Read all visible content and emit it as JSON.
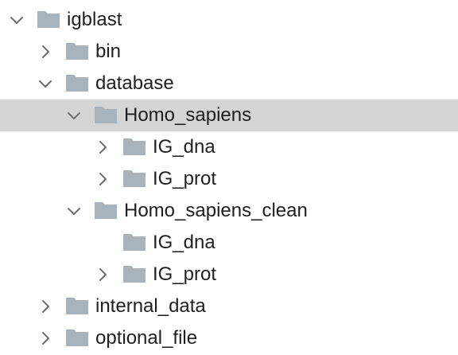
{
  "tree": {
    "root": {
      "label": "igblast",
      "expanded": true
    },
    "bin": {
      "label": "bin",
      "expanded": false
    },
    "database": {
      "label": "database",
      "expanded": true
    },
    "homo_sapiens": {
      "label": "Homo_sapiens",
      "expanded": true,
      "selected": true
    },
    "homo_sapiens_ig_dna": {
      "label": "IG_dna",
      "expanded": false
    },
    "homo_sapiens_ig_prot": {
      "label": "IG_prot",
      "expanded": false
    },
    "homo_sapiens_clean": {
      "label": "Homo_sapiens_clean",
      "expanded": true
    },
    "homo_sapiens_clean_ig_dna": {
      "label": "IG_dna",
      "has_children": false
    },
    "homo_sapiens_clean_ig_prot": {
      "label": "IG_prot",
      "expanded": false
    },
    "internal_data": {
      "label": "internal_data",
      "expanded": false
    },
    "optional_file": {
      "label": "optional_file",
      "expanded": false
    }
  },
  "colors": {
    "folder": "#a9b3bb",
    "selection": "#d5d5d5",
    "text": "#1f1f1f",
    "chevron": "#6e6e6e"
  },
  "icons": {
    "expanded": "chevron-down-icon",
    "collapsed": "chevron-right-icon",
    "folder": "folder-icon"
  }
}
